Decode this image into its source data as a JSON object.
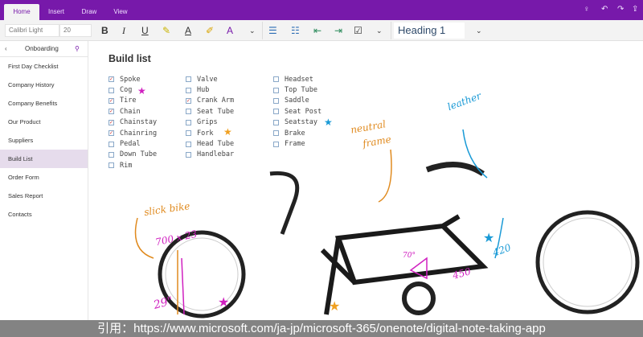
{
  "tabs": [
    "Home",
    "Insert",
    "Draw",
    "View"
  ],
  "toolbar": {
    "font": "Calibri Light",
    "size": "20",
    "bold": "B",
    "italic": "I",
    "underline": "U",
    "style": "Heading 1"
  },
  "sidebar": {
    "notebook": "Onboarding",
    "items": [
      "First Day Checklist",
      "Company History",
      "Company Benefits",
      "Our Product",
      "Suppliers",
      "Build List",
      "Order Form",
      "Sales Report",
      "Contacts"
    ],
    "selected": "Build List"
  },
  "page": {
    "title": "Build list",
    "columns": [
      [
        {
          "t": "Spoke",
          "c": true
        },
        {
          "t": "Cog",
          "c": false
        },
        {
          "t": "Tire",
          "c": true
        },
        {
          "t": "Chain",
          "c": true
        },
        {
          "t": "Chainstay",
          "c": true
        },
        {
          "t": "Chainring",
          "c": true
        },
        {
          "t": "Pedal",
          "c": false
        },
        {
          "t": "Down Tube",
          "c": false
        },
        {
          "t": "Rim",
          "c": false
        }
      ],
      [
        {
          "t": "Valve",
          "c": false
        },
        {
          "t": "Hub",
          "c": false
        },
        {
          "t": "Crank Arm",
          "c": true
        },
        {
          "t": "Seat Tube",
          "c": false
        },
        {
          "t": "Grips",
          "c": false
        },
        {
          "t": "Fork",
          "c": false
        },
        {
          "t": "Head Tube",
          "c": false
        },
        {
          "t": "Handlebar",
          "c": false
        }
      ],
      [
        {
          "t": "Headset",
          "c": false
        },
        {
          "t": "Top Tube",
          "c": false
        },
        {
          "t": "Saddle",
          "c": false
        },
        {
          "t": "Seat Post",
          "c": false
        },
        {
          "t": "Seatstay",
          "c": false
        },
        {
          "t": "Brake",
          "c": false
        },
        {
          "t": "Frame",
          "c": false
        }
      ]
    ]
  },
  "annotations": {
    "leather": "leather",
    "neutral": "neutral",
    "frame": "frame",
    "slick": "slick bike",
    "size": "700 x 23",
    "n420": "420",
    "n450": "450",
    "n29": "29\"",
    "angle": "70°"
  },
  "caption": "引用：https://www.microsoft.com/ja-jp/microsoft-365/onenote/digital-note-taking-app",
  "colors": {
    "accent": "#7719aa"
  }
}
